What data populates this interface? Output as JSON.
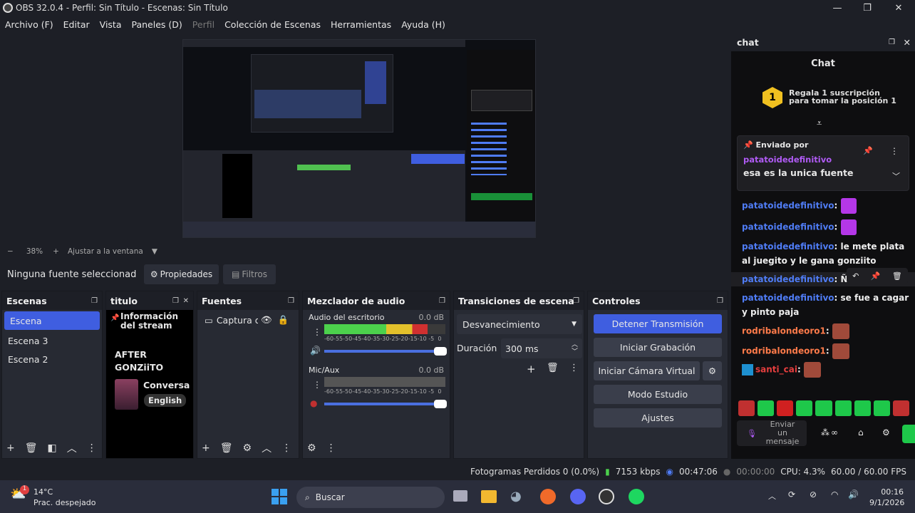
{
  "window": {
    "title": "OBS 32.0.4 - Perfil: Sin Título - Escenas: Sin Título",
    "min": "—",
    "max": "❐",
    "close": "✕"
  },
  "menu": [
    {
      "label": "Archivo (F)",
      "dim": false
    },
    {
      "label": "Editar",
      "dim": false
    },
    {
      "label": "Vista",
      "dim": false
    },
    {
      "label": "Paneles (D)",
      "dim": false
    },
    {
      "label": "Perfil",
      "dim": true
    },
    {
      "label": "Colección de Escenas",
      "dim": false
    },
    {
      "label": "Herramientas",
      "dim": false
    },
    {
      "label": "Ayuda (H)",
      "dim": false
    }
  ],
  "zoom": {
    "minus": "−",
    "value": "38%",
    "plus": "+",
    "fit": "Ajustar a la ventana"
  },
  "source_bar": {
    "none_selected": "Ninguna fuente seleccionad",
    "properties": "Propiedades",
    "filters": "Filtros"
  },
  "scenes": {
    "title": "Escenas",
    "items": [
      "Escena",
      "Escena 3",
      "Escena 2"
    ],
    "selected": 0
  },
  "titulo": {
    "title": "titulo",
    "info1": "Información",
    "info2": "del stream",
    "after1": "AFTER",
    "after2": "GONZiiTO",
    "conv": "Conversa",
    "lang": "English"
  },
  "sources": {
    "title": "Fuentes",
    "item": "Captura d"
  },
  "mixer": {
    "title": "Mezclador de audio",
    "channels": [
      {
        "name": "Audio del escritorio",
        "db": "0.0 dB",
        "level": 0.85
      },
      {
        "name": "Mic/Aux",
        "db": "0.0 dB",
        "level": 0.0
      }
    ],
    "scale": "-60-55-50-45-40-35-30-25-20-15-10 -5  0"
  },
  "transitions": {
    "title": "Transiciones de escena",
    "selected": "Desvanecimiento",
    "duration_label": "Duración",
    "duration_value": "300 ms"
  },
  "controls": {
    "title": "Controles",
    "buttons": [
      "Detener Transmisión",
      "Iniciar Grabación",
      "Iniciar Cámara Virtual",
      "Modo Estudio",
      "Ajustes"
    ]
  },
  "status": {
    "dropped": "Fotogramas Perdidos 0 (0.0%)",
    "bitrate": "7153 kbps",
    "stream_time": "00:47:06",
    "rec_time": "00:00:00",
    "cpu": "CPU: 4.3%",
    "fps": "60.00 / 60.00 FPS"
  },
  "chat": {
    "dock_title": "chat",
    "title": "Chat",
    "sub_rank": "1",
    "sub_text1": "Regala 1 suscripción",
    "sub_text2": "para tomar la posición 1",
    "pinned_label": "Enviado por",
    "pinned_user": "patatoidedefinitivo",
    "pinned_msg": "esa es la unica fuente",
    "messages": [
      {
        "user": "patatoidedefinitivo",
        "text": ":",
        "emote": true
      },
      {
        "user": "patatoidedefinitivo",
        "text": ":",
        "emote": true
      },
      {
        "user": "patatoidedefinitivo",
        "text": ": le mete plata al juegito y le gana gonziito"
      },
      {
        "user": "patatoidedefinitivo",
        "text": ": ÑOM"
      },
      {
        "user": "patatoidedefinitivo",
        "text": ": se fue a cagar y pinto paja"
      },
      {
        "user": "rodribalondeoro1",
        "text": ":",
        "emote": true
      },
      {
        "user": "rodribalondeoro1",
        "text": ":",
        "emote": true
      },
      {
        "user": "santi_cai",
        "text": ":",
        "emote": true
      }
    ],
    "input_placeholder": "Enviar un mensaje"
  },
  "taskbar": {
    "weather_temp": "14°C",
    "weather_desc": "Prac. despejado",
    "weather_badge": "1",
    "search": "Buscar",
    "time": "00:16",
    "date": "9/1/2026"
  },
  "colors": {
    "accent": "#3f5ee0",
    "panel": "#272a33",
    "bg": "#1d1f26",
    "twitch_user": "#4f7cf5"
  }
}
